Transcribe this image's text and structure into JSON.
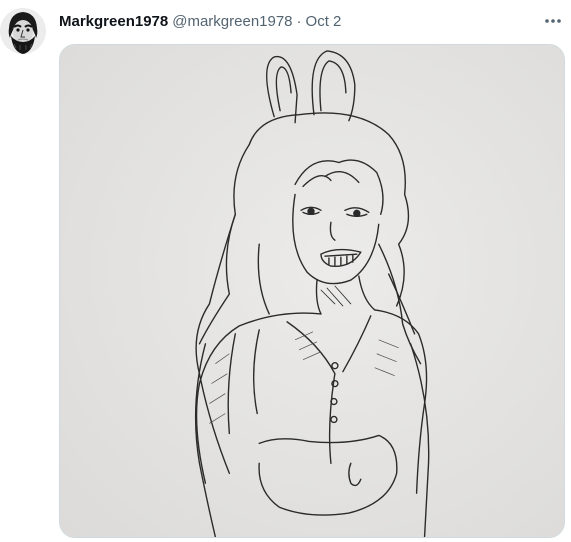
{
  "tweet": {
    "display_name": "Markgreen1978",
    "handle": "@markgreen1978",
    "separator": "·",
    "date": "Oct 2"
  },
  "icons": {
    "more": "more-horizontal-icon",
    "avatar": "bearded-man-portrait"
  },
  "colors": {
    "name": "#0f1419",
    "secondary": "#536471",
    "media_border": "#cfd9de",
    "paper": "#e7e7e5"
  }
}
